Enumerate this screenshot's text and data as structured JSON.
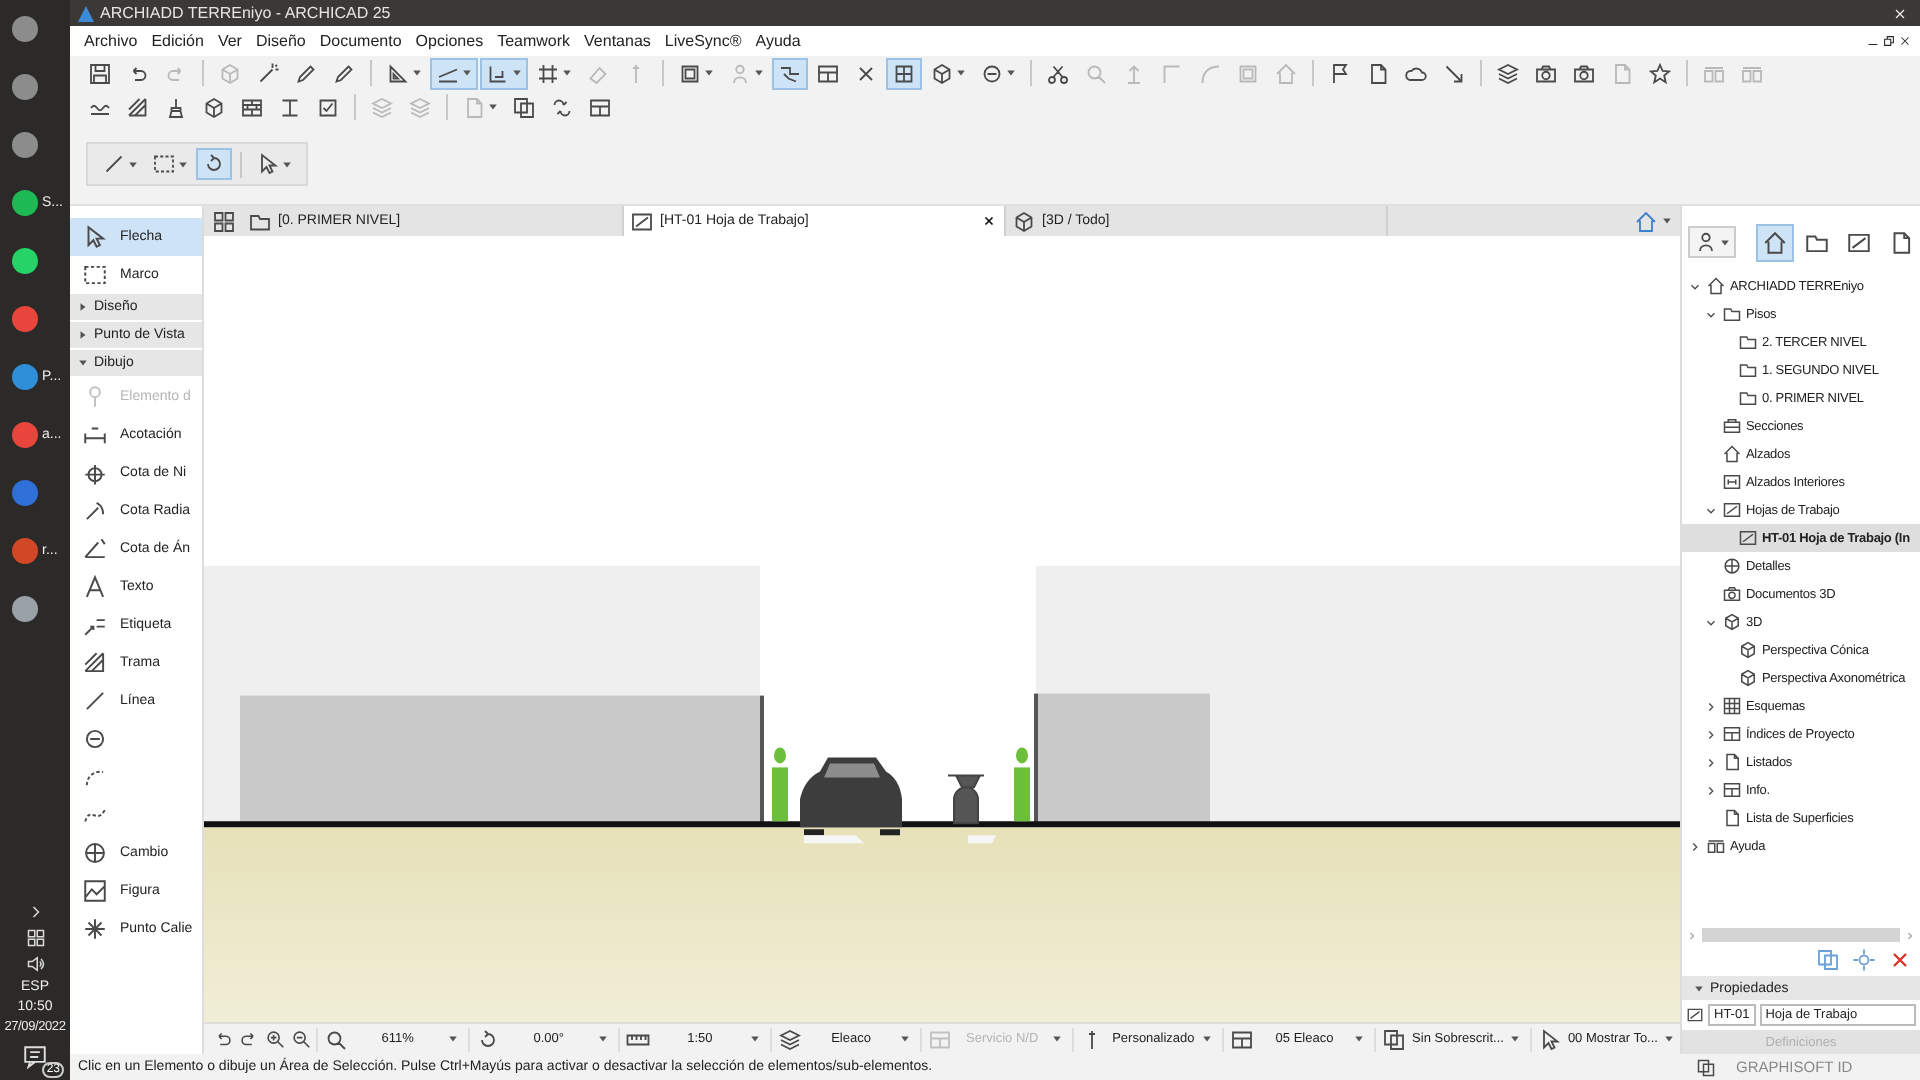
{
  "window": {
    "title": "ARCHIADD TERREniyo - ARCHICAD 25"
  },
  "taskbar": {
    "apps": [
      {
        "color": "#8c8c8c"
      },
      {
        "color": "#8c8c8c"
      },
      {
        "color": "#8c8c8c"
      },
      {
        "color": "#1db954",
        "label": "S..."
      },
      {
        "color": "#25d366"
      },
      {
        "color": "#e8453c"
      },
      {
        "color": "#2f8fd8",
        "label": "P..."
      },
      {
        "color": "#e8453c",
        "label": "a..."
      },
      {
        "color": "#2f6fd8"
      },
      {
        "color": "#d24726",
        "label": "r..."
      },
      {
        "color": "#9aa0a8"
      }
    ],
    "language": "ESP",
    "time": "10:50",
    "date": "27/09/2022",
    "notifications": "23"
  },
  "menu": [
    "Archivo",
    "Edición",
    "Ver",
    "Diseño",
    "Documento",
    "Opciones",
    "Teamwork",
    "Ventanas",
    "LiveSync®",
    "Ayuda"
  ],
  "toolbar": {
    "rows": [
      [
        {
          "on": false,
          "disabled": false
        },
        {
          "on": false,
          "disabled": false
        },
        {
          "on": false,
          "disabled": true
        },
        {
          "on": false,
          "disabled": true
        },
        {
          "on": false,
          "disabled": false
        },
        {
          "on": false,
          "disabled": false
        },
        {
          "on": false,
          "disabled": false
        },
        {
          "on": false,
          "disabled": false
        },
        {
          "on": true,
          "disabled": false
        },
        {
          "on": true,
          "disabled": false
        },
        {
          "on": false,
          "disabled": false
        },
        {
          "on": false,
          "disabled": true
        },
        {
          "on": false,
          "disabled": true
        },
        {
          "on": false,
          "disabled": false
        },
        {
          "on": false,
          "disabled": true
        },
        {
          "on": true,
          "disabled": false
        },
        {
          "on": false,
          "disabled": false
        },
        {
          "on": false,
          "disabled": false
        },
        {
          "on": true,
          "disabled": false
        },
        {
          "on": false,
          "disabled": false
        },
        {
          "on": false,
          "disabled": false
        },
        {
          "on": false,
          "disabled": false
        },
        {
          "on": false,
          "disabled": true
        },
        {
          "on": false,
          "disabled": true
        },
        {
          "on": false,
          "disabled": true
        },
        {
          "on": false,
          "disabled": true
        },
        {
          "on": false,
          "disabled": true
        },
        {
          "on": false,
          "disabled": true
        },
        {
          "on": false,
          "disabled": false
        },
        {
          "on": false,
          "disabled": false
        },
        {
          "on": false,
          "disabled": false
        },
        {
          "on": false,
          "disabled": false
        },
        {
          "on": false,
          "disabled": false
        },
        {
          "on": false,
          "disabled": false
        },
        {
          "on": false,
          "disabled": false
        },
        {
          "on": false,
          "disabled": true
        },
        {
          "on": false,
          "disabled": false
        },
        {
          "on": false,
          "disabled": true
        },
        {
          "on": false,
          "disabled": true
        }
      ],
      [
        {
          "on": false,
          "disabled": false
        },
        {
          "on": false,
          "disabled": false
        },
        {
          "on": false,
          "disabled": false
        },
        {
          "on": false,
          "disabled": false
        },
        {
          "on": false,
          "disabled": false
        },
        {
          "on": false,
          "disabled": false
        },
        {
          "on": false,
          "disabled": false
        },
        {
          "on": false,
          "disabled": true
        },
        {
          "on": false,
          "disabled": true
        },
        {
          "on": false,
          "disabled": true
        },
        {
          "on": false,
          "disabled": false
        },
        {
          "on": false,
          "disabled": false
        },
        {
          "on": false,
          "disabled": false
        }
      ],
      [
        {
          "on": false,
          "disabled": false
        },
        {
          "on": false,
          "disabled": false
        },
        {
          "on": true,
          "disabled": false
        },
        {
          "on": false,
          "disabled": false
        }
      ]
    ]
  },
  "toolbox": {
    "items": [
      {
        "kind": "tool",
        "label": "Flecha",
        "selected": true,
        "disabled": false
      },
      {
        "kind": "tool",
        "label": "Marco",
        "selected": false,
        "disabled": false
      },
      {
        "kind": "group",
        "label": "Diseño",
        "expanded": false
      },
      {
        "kind": "group",
        "label": "Punto de Vista",
        "expanded": false
      },
      {
        "kind": "group",
        "label": "Dibujo",
        "expanded": true,
        "children": [
          {
            "kind": "tool",
            "label": "Elemento d",
            "selected": false,
            "disabled": true
          },
          {
            "kind": "tool",
            "label": "Acotación",
            "selected": false,
            "disabled": false
          },
          {
            "kind": "tool",
            "label": "Cota de Ni",
            "selected": false,
            "disabled": false
          },
          {
            "kind": "tool",
            "label": "Cota Radia",
            "selected": false,
            "disabled": false
          },
          {
            "kind": "tool",
            "label": "Cota de Án",
            "selected": false,
            "disabled": false
          },
          {
            "kind": "tool",
            "label": "Texto",
            "selected": false,
            "disabled": false
          },
          {
            "kind": "tool",
            "label": "Etiqueta",
            "selected": false,
            "disabled": false
          },
          {
            "kind": "tool",
            "label": "Trama",
            "selected": false,
            "disabled": false
          },
          {
            "kind": "tool",
            "label": "Línea",
            "selected": false,
            "disabled": false
          },
          {
            "kind": "tool",
            "selected": false,
            "disabled": false
          },
          {
            "kind": "tool",
            "selected": false,
            "disabled": false
          },
          {
            "kind": "tool",
            "selected": false,
            "disabled": false
          },
          {
            "kind": "tool",
            "label": "Cambio",
            "selected": false,
            "disabled": false
          },
          {
            "kind": "tool",
            "label": "Figura",
            "selected": false,
            "disabled": false
          },
          {
            "kind": "tool",
            "label": "Punto Calie",
            "selected": false,
            "disabled": false
          }
        ]
      }
    ]
  },
  "tabs": [
    {
      "label": "[0. PRIMER NIVEL]",
      "kind": "floor",
      "selected": false
    },
    {
      "label": "[HT-01 Hoja de Trabajo]",
      "kind": "worksheet",
      "selected": true
    },
    {
      "label": "[3D / Todo]",
      "kind": "model3d",
      "selected": false
    }
  ],
  "view_options": [
    {
      "value": "611%",
      "disabled": false
    },
    {
      "value": "0.00°",
      "disabled": false
    },
    {
      "value": "1:50",
      "disabled": false
    },
    {
      "value": "Eleaco",
      "disabled": false
    },
    {
      "value": "Servicio N/D",
      "disabled": true
    },
    {
      "value": "Personalizado",
      "disabled": false
    },
    {
      "value": "05 Eleaco",
      "disabled": false
    },
    {
      "value": "Sin Sobrescrit...",
      "disabled": false
    },
    {
      "value": "00 Mostrar To...",
      "disabled": false
    }
  ],
  "navigator": {
    "tabs": [
      {
        "selected": true
      },
      {
        "selected": false
      },
      {
        "selected": false
      },
      {
        "selected": false
      }
    ],
    "tree": [
      {
        "kind": "project",
        "label": "ARCHIADD TERREniyo",
        "expanded": true,
        "selected": false,
        "children": [
          {
            "kind": "folder",
            "label": "Pisos",
            "expanded": true,
            "selected": false,
            "children": [
              {
                "kind": "floor",
                "label": "2. TERCER NIVEL",
                "selected": false
              },
              {
                "kind": "floor",
                "label": "1. SEGUNDO NIVEL",
                "selected": false
              },
              {
                "kind": "floor",
                "label": "0. PRIMER NIVEL",
                "selected": false
              }
            ]
          },
          {
            "kind": "section",
            "label": "Secciones",
            "selected": false
          },
          {
            "kind": "elevation",
            "label": "Alzados",
            "selected": false
          },
          {
            "kind": "interior",
            "label": "Alzados Interiores",
            "selected": false
          },
          {
            "kind": "worksheet",
            "label": "Hojas de Trabajo",
            "expanded": true,
            "selected": false,
            "children": [
              {
                "kind": "worksheet",
                "label": "HT-01 Hoja de Trabajo (In",
                "selected": true
              }
            ]
          },
          {
            "kind": "detail",
            "label": "Detalles",
            "selected": false
          },
          {
            "kind": "document3d",
            "label": "Documentos 3D",
            "selected": false
          },
          {
            "kind": "model3d",
            "label": "3D",
            "expanded": true,
            "selected": false,
            "children": [
              {
                "kind": "perspective",
                "label": "Perspectiva Cónica",
                "selected": false
              },
              {
                "kind": "axonometry",
                "label": "Perspectiva Axonométrica",
                "selected": false
              }
            ]
          },
          {
            "kind": "schedule",
            "label": "Esquemas",
            "expanded": false,
            "selected": false
          },
          {
            "kind": "index",
            "label": "Índices de Proyecto",
            "expanded": false,
            "selected": false
          },
          {
            "kind": "list",
            "label": "Listados",
            "expanded": false,
            "selected": false
          },
          {
            "kind": "info",
            "label": "Info.",
            "expanded": false,
            "selected": false
          },
          {
            "kind": "list",
            "label": "Lista de Superficies",
            "selected": false
          }
        ]
      },
      {
        "kind": "help",
        "label": "Ayuda",
        "expanded": false,
        "selected": false
      }
    ]
  },
  "properties": {
    "title": "Propiedades",
    "expanded": true,
    "id": "HT-01",
    "name": "Hoja de Trabajo",
    "button": {
      "label": "Definiciones",
      "disabled": true
    }
  },
  "account": "GRAPHISOFT ID",
  "status": "Clic en un Elemento o dibuje un Área de Selección. Pulse Ctrl+Mayús para activar o desactivar la selección de elementos/sub-elementos."
}
